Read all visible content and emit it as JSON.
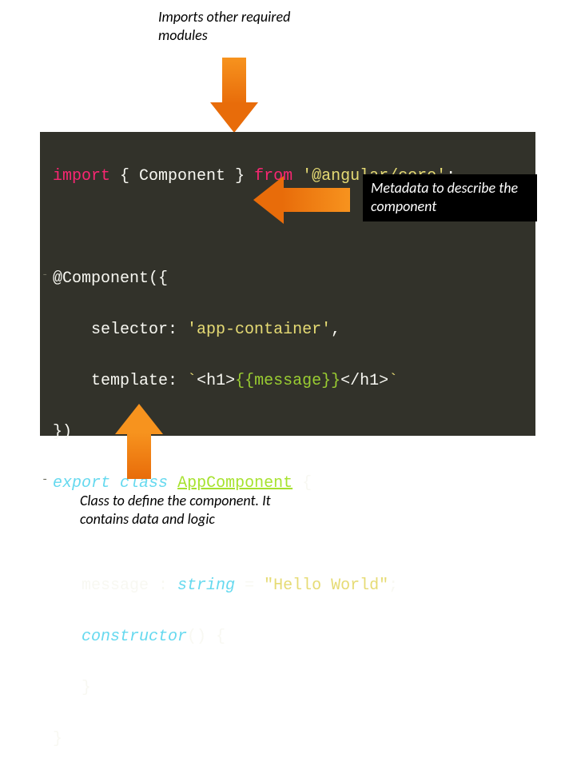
{
  "annotations": {
    "top": "Imports other required modules",
    "right": "Metadata to describe the component",
    "bottom": "Class to define the component. It contains data and logic"
  },
  "code": {
    "line1": {
      "import": "import",
      "brace_open": " { ",
      "component": "Component",
      "brace_close": " } ",
      "from": "from",
      "space": " ",
      "module": "'@angular/core'",
      "semi": ";"
    },
    "line3": {
      "decorator": "@Component",
      "paren": "({"
    },
    "line4": {
      "indent": "    ",
      "key": "selector",
      "colon": ": ",
      "value": "'app-container'",
      "comma": ","
    },
    "line5": {
      "indent": "    ",
      "key": "template",
      "colon": ": ",
      "tick1": "`",
      "tag_open": "<h1>",
      "expr": "{{message}}",
      "tag_close": "</h1>",
      "tick2": "`"
    },
    "line6": {
      "close": "})"
    },
    "line7": {
      "export": "export",
      "sp1": " ",
      "class_kw": "class",
      "sp2": " ",
      "classname": "AppComponent",
      "sp3": " ",
      "brace": "{"
    },
    "line9": {
      "indent": "   ",
      "name": "message",
      "colon": " : ",
      "type": "string",
      "eq": " = ",
      "value": "\"Hello World\"",
      "semi": ";"
    },
    "line10": {
      "indent": "   ",
      "ctor": "constructor",
      "rest": "() {"
    },
    "line11": {
      "indent": "   ",
      "brace": "}"
    },
    "line12": {
      "brace": "}"
    }
  }
}
